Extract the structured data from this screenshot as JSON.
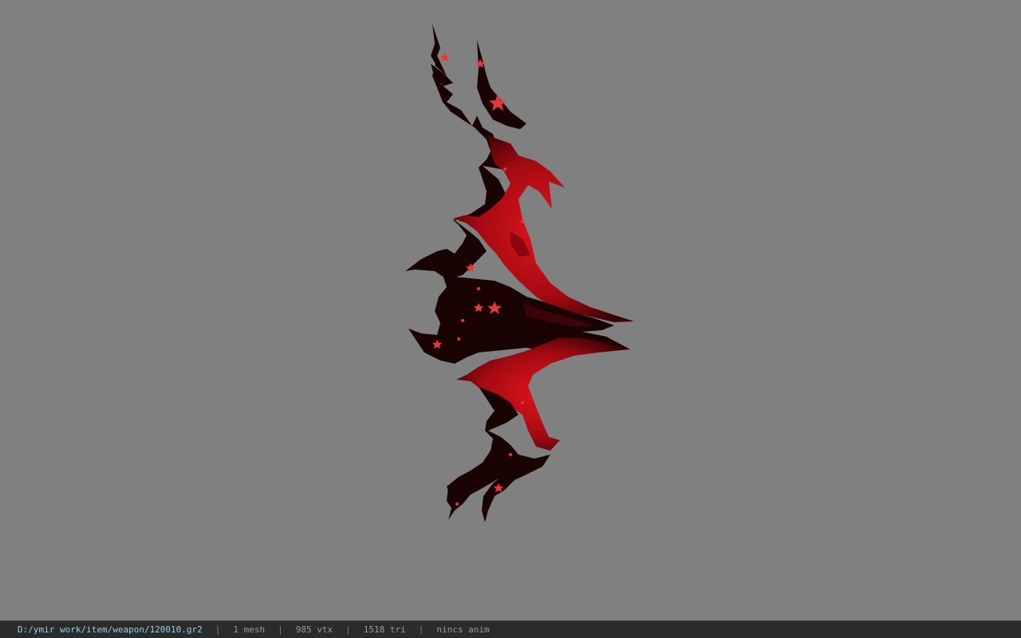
{
  "viewer": {
    "background_color": "#808080",
    "model": {
      "name": "red-black-thorned-bow",
      "primary_color": "#c8101a",
      "dark_color": "#1a0303",
      "accent_color": "#e23a3a"
    }
  },
  "status_bar": {
    "file_path": "D:/ymir work/item/weapon/120010.gr2",
    "mesh_count": "1 mesh",
    "vertex_count": "985 vtx",
    "triangle_count": "1518 tri",
    "animation": "nincs anim",
    "separator": "|",
    "path_color": "#8fd3e8",
    "text_color": "#9a9a9a",
    "background_color": "#2b2b2b"
  }
}
